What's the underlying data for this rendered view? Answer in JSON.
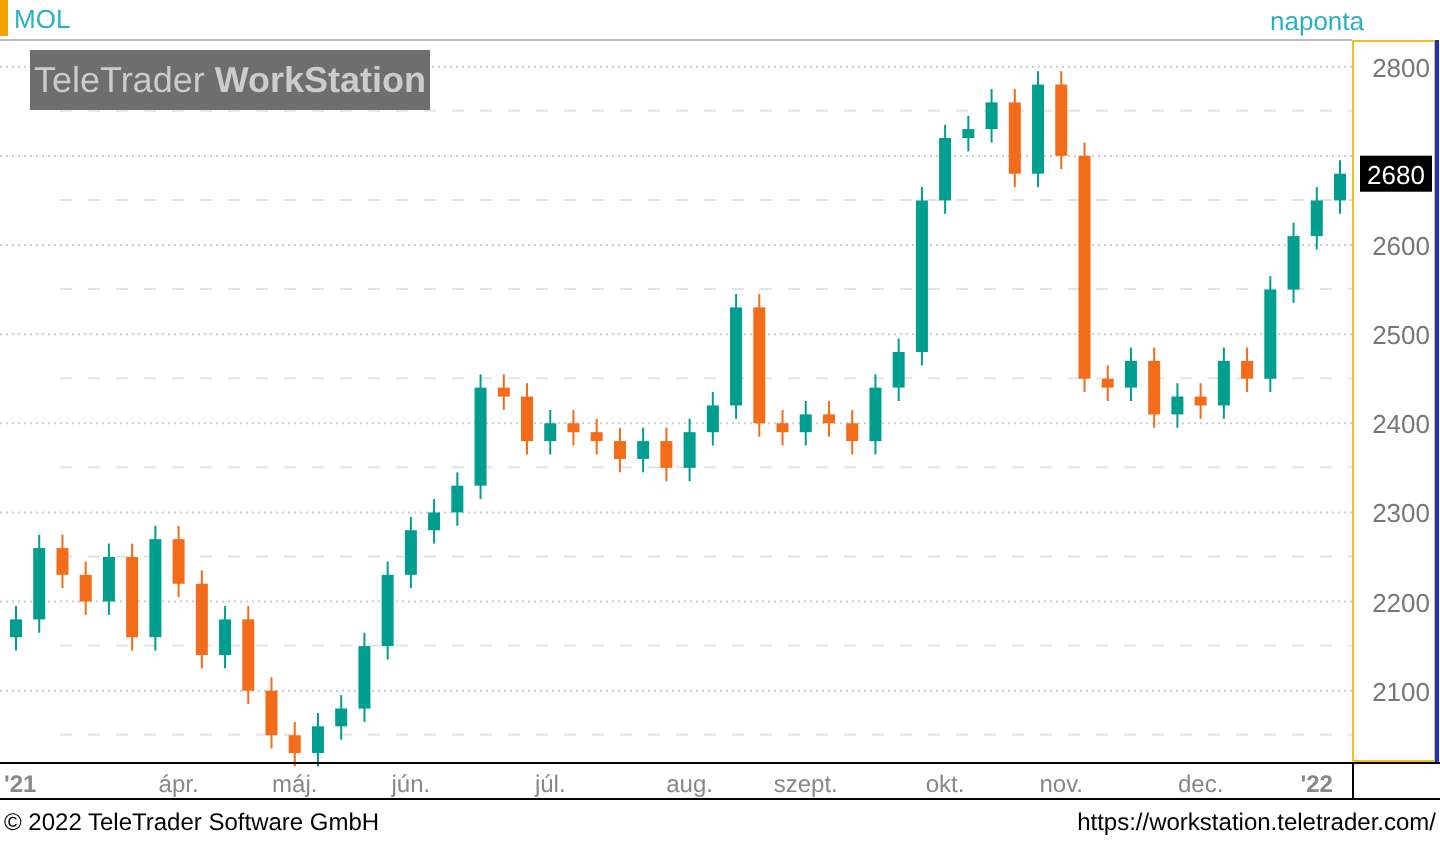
{
  "instrument": "MOL",
  "interval": "naponta",
  "logo": {
    "light": "TeleTrader ",
    "bold": "WorkStation"
  },
  "last_price": "2680",
  "chart": {
    "chart_data": {
      "type": "candlestick",
      "categories": [
        "'21",
        null,
        null,
        null,
        null,
        null,
        null,
        "ápr.",
        null,
        null,
        null,
        null,
        "máj.",
        null,
        null,
        null,
        null,
        "jún.",
        null,
        null,
        null,
        null,
        null,
        "júl.",
        null,
        null,
        null,
        null,
        null,
        "aug.",
        null,
        null,
        null,
        null,
        "szept.",
        null,
        null,
        null,
        null,
        null,
        "okt.",
        null,
        null,
        null,
        null,
        "nov.",
        null,
        null,
        null,
        null,
        null,
        "dec.",
        null,
        null,
        null,
        null,
        "'22",
        null
      ],
      "ohlc": [
        [
          2160,
          2195,
          2145,
          2180
        ],
        [
          2180,
          2275,
          2165,
          2260
        ],
        [
          2260,
          2275,
          2215,
          2230
        ],
        [
          2230,
          2245,
          2185,
          2200
        ],
        [
          2200,
          2265,
          2185,
          2250
        ],
        [
          2250,
          2265,
          2145,
          2160
        ],
        [
          2160,
          2285,
          2145,
          2270
        ],
        [
          2270,
          2285,
          2205,
          2220
        ],
        [
          2220,
          2235,
          2125,
          2140
        ],
        [
          2140,
          2195,
          2125,
          2180
        ],
        [
          2180,
          2195,
          2085,
          2100
        ],
        [
          2100,
          2115,
          2035,
          2050
        ],
        [
          2050,
          2065,
          2015,
          2030
        ],
        [
          2030,
          2075,
          2015,
          2060
        ],
        [
          2060,
          2095,
          2045,
          2080
        ],
        [
          2080,
          2165,
          2065,
          2150
        ],
        [
          2150,
          2245,
          2135,
          2230
        ],
        [
          2230,
          2295,
          2215,
          2280
        ],
        [
          2280,
          2315,
          2265,
          2300
        ],
        [
          2300,
          2345,
          2285,
          2330
        ],
        [
          2330,
          2455,
          2315,
          2440
        ],
        [
          2440,
          2455,
          2415,
          2430
        ],
        [
          2430,
          2445,
          2365,
          2380
        ],
        [
          2380,
          2415,
          2365,
          2400
        ],
        [
          2400,
          2415,
          2375,
          2390
        ],
        [
          2390,
          2405,
          2365,
          2380
        ],
        [
          2380,
          2395,
          2345,
          2360
        ],
        [
          2360,
          2395,
          2345,
          2380
        ],
        [
          2380,
          2395,
          2335,
          2350
        ],
        [
          2350,
          2405,
          2335,
          2390
        ],
        [
          2390,
          2435,
          2375,
          2420
        ],
        [
          2420,
          2545,
          2405,
          2530
        ],
        [
          2530,
          2545,
          2385,
          2400
        ],
        [
          2400,
          2415,
          2375,
          2390
        ],
        [
          2390,
          2425,
          2375,
          2410
        ],
        [
          2410,
          2425,
          2385,
          2400
        ],
        [
          2400,
          2415,
          2365,
          2380
        ],
        [
          2380,
          2455,
          2365,
          2440
        ],
        [
          2440,
          2495,
          2425,
          2480
        ],
        [
          2480,
          2665,
          2465,
          2650
        ],
        [
          2650,
          2735,
          2635,
          2720
        ],
        [
          2720,
          2745,
          2705,
          2730
        ],
        [
          2730,
          2775,
          2715,
          2760
        ],
        [
          2760,
          2775,
          2665,
          2680
        ],
        [
          2680,
          2795,
          2665,
          2780
        ],
        [
          2780,
          2795,
          2685,
          2700
        ],
        [
          2700,
          2715,
          2435,
          2450
        ],
        [
          2450,
          2465,
          2425,
          2440
        ],
        [
          2440,
          2485,
          2425,
          2470
        ],
        [
          2470,
          2485,
          2395,
          2410
        ],
        [
          2410,
          2445,
          2395,
          2430
        ],
        [
          2430,
          2445,
          2405,
          2420
        ],
        [
          2420,
          2485,
          2405,
          2470
        ],
        [
          2470,
          2485,
          2435,
          2450
        ],
        [
          2450,
          2565,
          2435,
          2550
        ],
        [
          2550,
          2625,
          2535,
          2610
        ],
        [
          2610,
          2665,
          2595,
          2650
        ],
        [
          2650,
          2695,
          2635,
          2680
        ]
      ],
      "ylim": [
        2020,
        2830
      ],
      "grid": true,
      "yticks": [
        2100,
        2200,
        2300,
        2400,
        2500,
        2600,
        2800
      ]
    }
  },
  "footer": {
    "copyright": "© 2022 TeleTrader Software GmbH",
    "url": "https://workstation.teletrader.com/"
  }
}
